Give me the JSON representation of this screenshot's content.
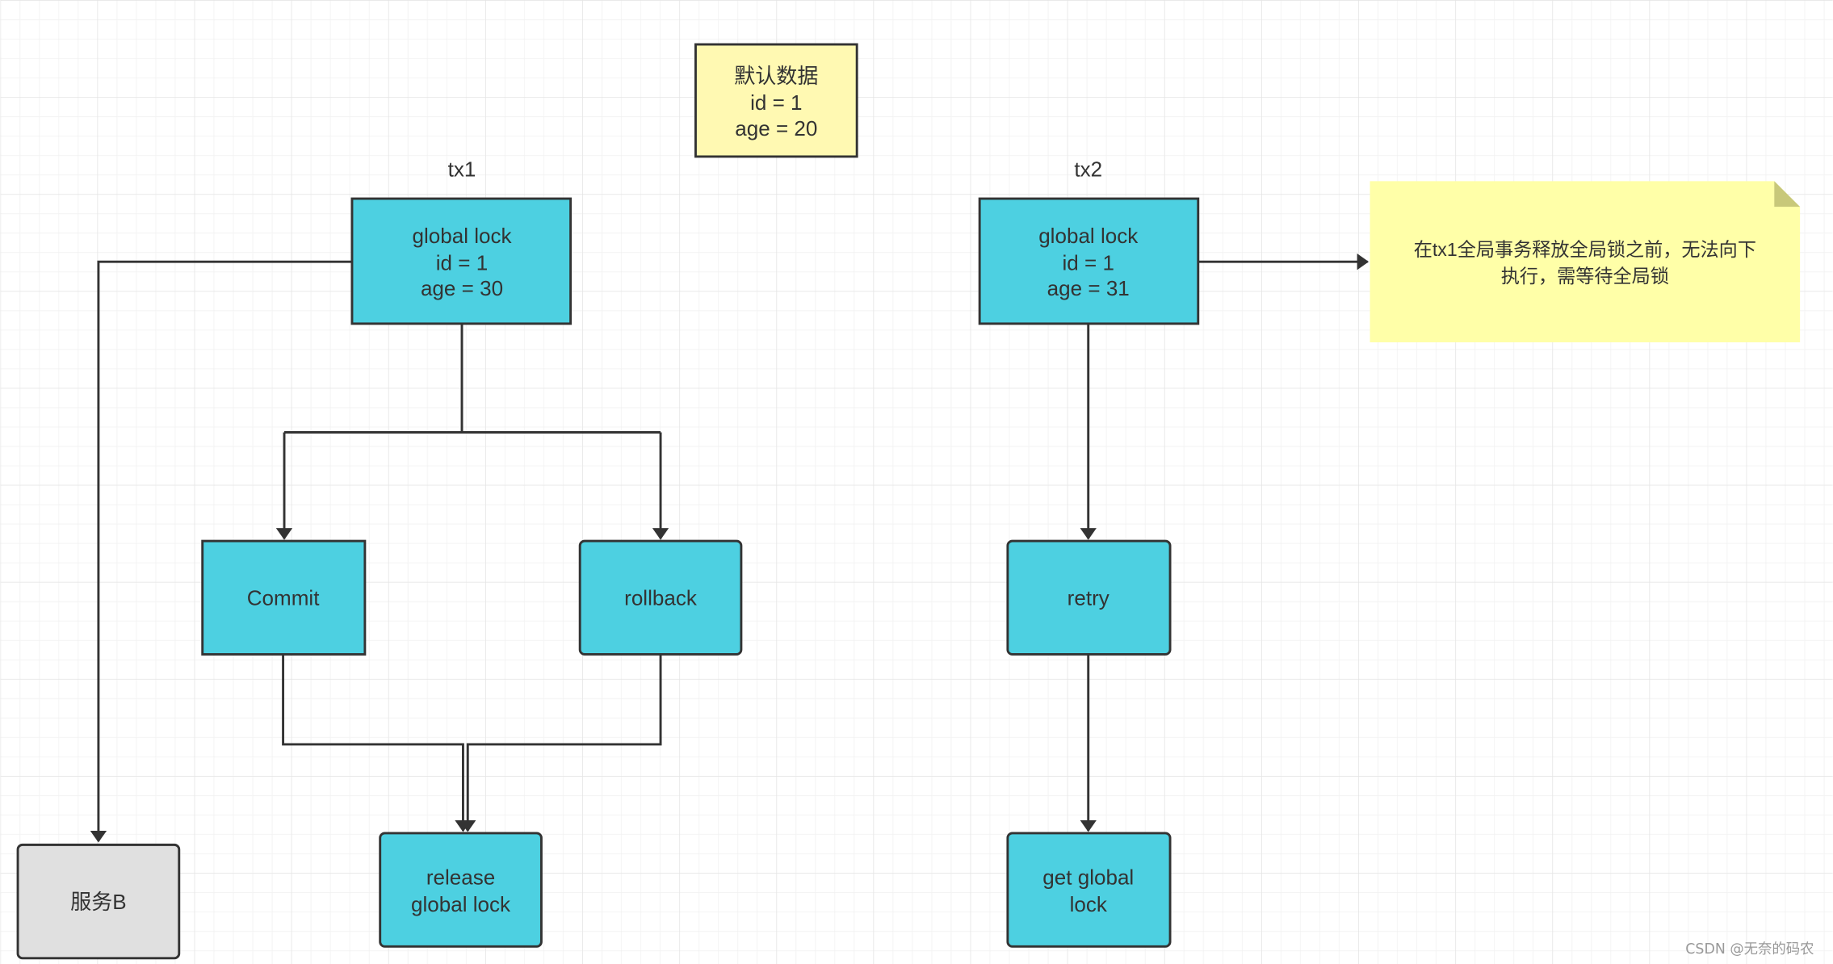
{
  "colors": {
    "process_fill": "#4dd0e1",
    "data_fill": "#fff9b2",
    "note_fill": "#ffffa8",
    "service_fill": "#e0e0e0",
    "stroke": "#333333"
  },
  "default_data": {
    "lines": [
      "默认数据",
      "id = 1",
      "age = 20"
    ]
  },
  "tx1": {
    "label": "tx1",
    "global_lock": [
      "global lock",
      "id = 1",
      "age = 30"
    ]
  },
  "tx2": {
    "label": "tx2",
    "global_lock": [
      "global lock",
      "id = 1",
      "age = 31"
    ]
  },
  "note": {
    "lines": [
      "在tx1全局事务释放全局锁之前，无法向下",
      "执行，需等待全局锁"
    ]
  },
  "nodes": {
    "commit": "Commit",
    "rollback": "rollback",
    "retry": "retry",
    "service_b": "服务B",
    "release": [
      "release",
      "global lock"
    ],
    "get_lock": [
      "get global",
      "lock"
    ]
  },
  "watermark": "CSDN @无奈的码农"
}
